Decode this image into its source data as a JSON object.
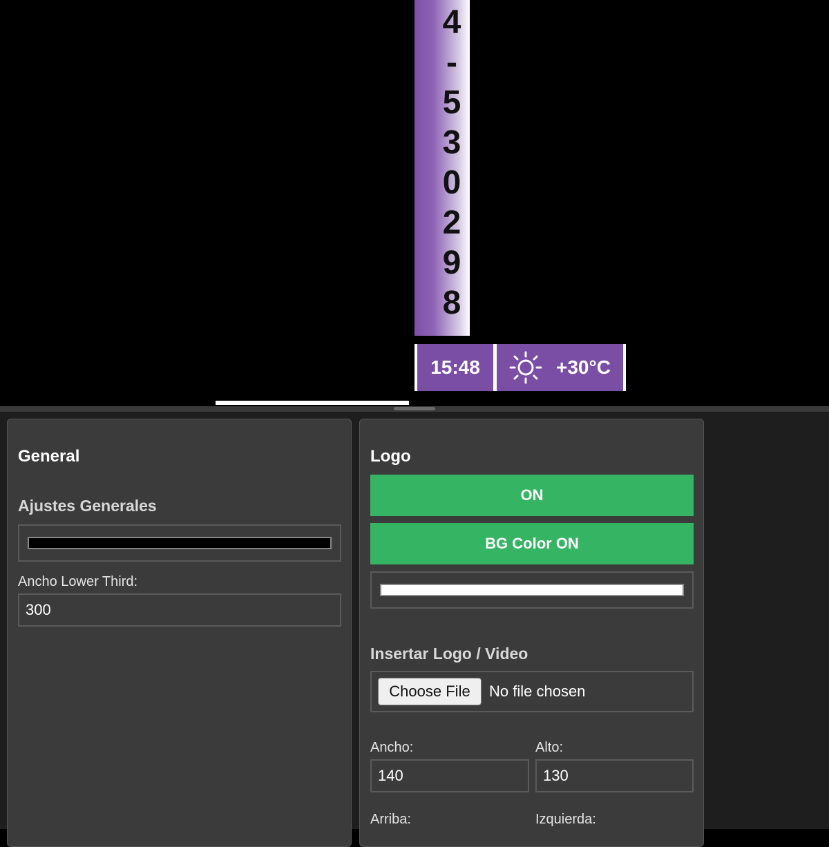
{
  "preview": {
    "ticker_digits": [
      "4",
      "-",
      "5",
      "3",
      "0",
      "2",
      "9",
      "8"
    ],
    "clock": "15:48",
    "weather_icon": "sun-icon",
    "temperature": "+30°C",
    "colors": {
      "accent_purple": "#7b4ea6",
      "background": "#000000"
    }
  },
  "general_panel": {
    "title": "General",
    "section_title": "Ajustes Generales",
    "color_value": "#000000",
    "width_label": "Ancho Lower Third:",
    "width_value": "300"
  },
  "logo_panel": {
    "title": "Logo",
    "on_button": "ON",
    "bg_color_button": "BG Color ON",
    "bg_color_value": "#ffffff",
    "insert_title": "Insertar Logo / Video",
    "choose_file_label": "Choose File",
    "no_file_text": "No file chosen",
    "ancho_label": "Ancho:",
    "ancho_value": "140",
    "alto_label": "Alto:",
    "alto_value": "130",
    "arriba_label": "Arriba:",
    "izquierda_label": "Izquierda:",
    "colors": {
      "button_green": "#35b463"
    }
  }
}
